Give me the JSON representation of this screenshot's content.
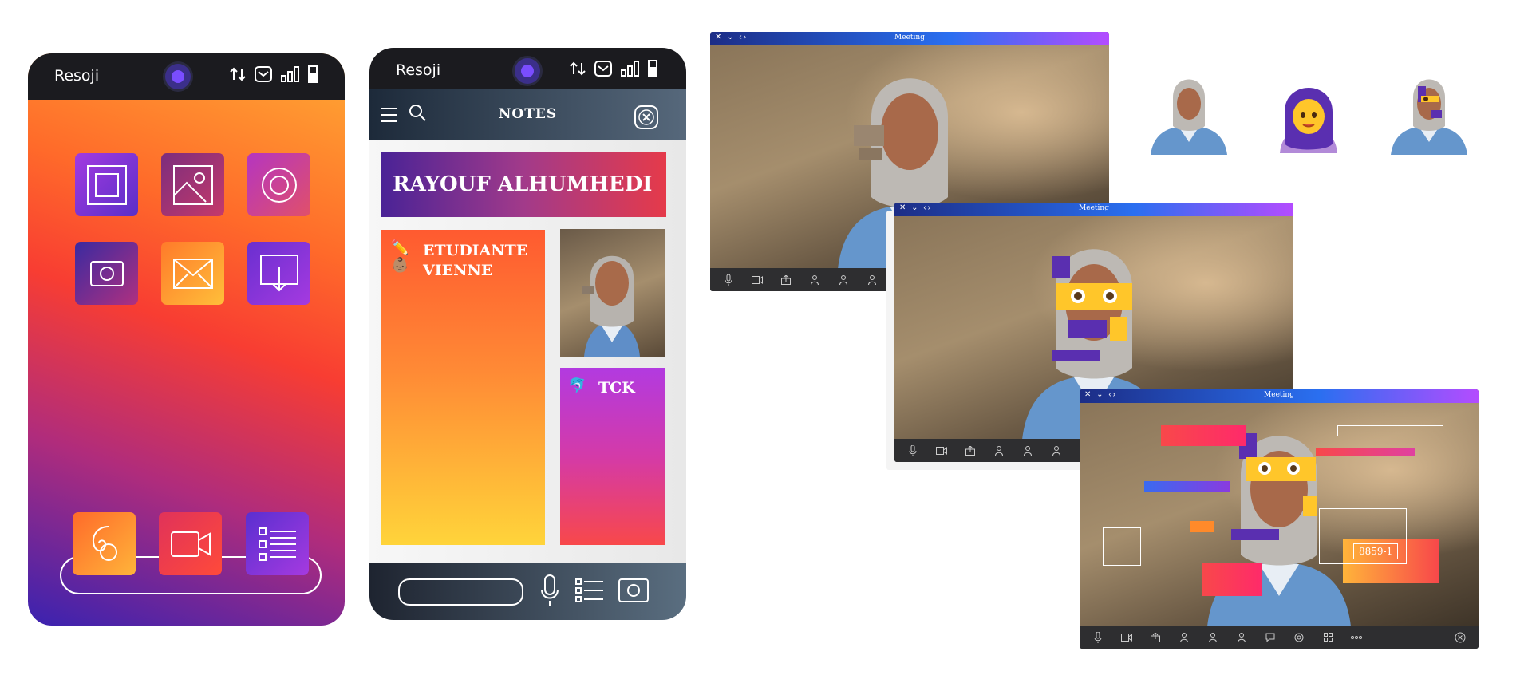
{
  "phone1": {
    "brand": "Resoji",
    "apps": [
      "frame-icon",
      "image-icon",
      "target-icon",
      "photo-icon",
      "mail-icon",
      "download-icon"
    ],
    "dock": [
      "character-icon",
      "video-icon",
      "list-icon"
    ]
  },
  "phone2": {
    "brand": "Resoji",
    "title": "NOTES",
    "name": "RAYOUF ALHUMHEDI",
    "card1": {
      "emoji1": "✏️",
      "emoji2": "👶🏽",
      "line1": "ETUDIANTE",
      "line2": "VIENNE"
    },
    "card2": {
      "emoji": "🐬",
      "text": "TCK"
    }
  },
  "meeting": {
    "title": "Meeting",
    "controls": "✕ ⌄ ‹›",
    "overlay_label": "8859-1"
  },
  "thumbnails": [
    "person-photo",
    "hijab-emoji",
    "person-with-emoji"
  ],
  "colors": {
    "accent": "#7a4dff",
    "orange": "#ff6a2a",
    "magenta": "#c53aa0",
    "titlebar": "#2a6ff0"
  }
}
